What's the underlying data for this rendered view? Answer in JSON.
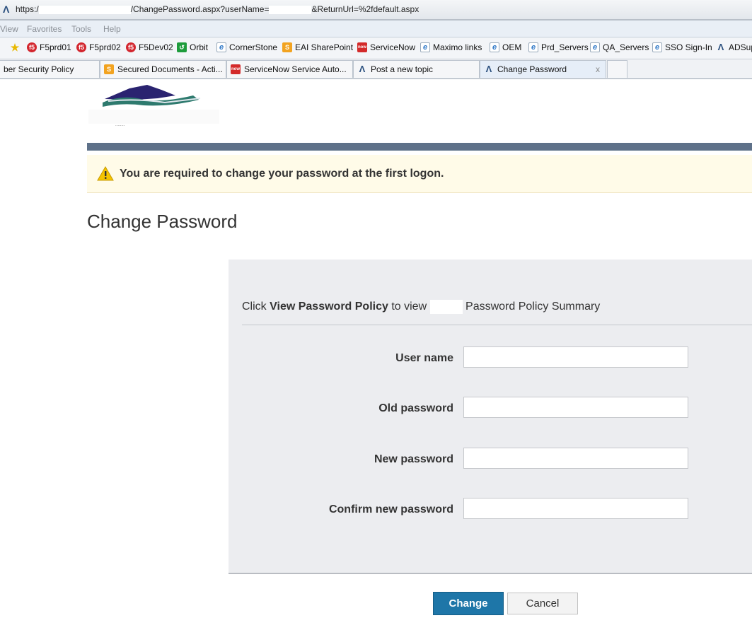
{
  "browser": {
    "address_bar": {
      "prefix": "https:/",
      "path": "/ChangePassword.aspx?userName=",
      "suffix": "&ReturnUrl=%2fdefault.aspx"
    },
    "menu": [
      "View",
      "Favorites",
      "Tools",
      "Help"
    ],
    "favorites": [
      {
        "icon": "f5-icon",
        "label": "F5prd01"
      },
      {
        "icon": "f5-icon",
        "label": "F5prd02"
      },
      {
        "icon": "f5-icon",
        "label": "F5Dev02"
      },
      {
        "icon": "orbit-icon",
        "label": "Orbit"
      },
      {
        "icon": "ie-page-icon",
        "label": "CornerStone"
      },
      {
        "icon": "sharepoint-icon",
        "label": "EAI SharePoint"
      },
      {
        "icon": "servicenow-icon",
        "label": "ServiceNow"
      },
      {
        "icon": "ie-page-icon",
        "label": "Maximo links"
      },
      {
        "icon": "ie-page-icon",
        "label": "OEM"
      },
      {
        "icon": "ie-page-icon",
        "label": "Prd_Servers"
      },
      {
        "icon": "ie-page-icon",
        "label": "QA_Servers"
      },
      {
        "icon": "ie-page-icon",
        "label": "SSO Sign-In"
      },
      {
        "icon": "site-icon",
        "label": "ADSup"
      }
    ],
    "tabs": [
      {
        "label": "ber Security Policy",
        "active": false
      },
      {
        "label": "Secured Documents - Acti...",
        "active": false
      },
      {
        "label": "ServiceNow Service Auto...",
        "active": false
      },
      {
        "label": "Post a new topic",
        "active": false
      },
      {
        "label": "Change Password",
        "active": true
      }
    ],
    "tab_close": "x"
  },
  "page": {
    "warning": "You are required to change your password at the first logon.",
    "title": "Change Password",
    "policy": {
      "pre": "Click ",
      "link": "View Password Policy",
      "mid": " to view ",
      "post": " Password Policy Summary"
    },
    "fields": [
      {
        "label": "User name",
        "value": ""
      },
      {
        "label": "Old password",
        "value": ""
      },
      {
        "label": "New password",
        "value": ""
      },
      {
        "label": "Confirm new password",
        "value": ""
      }
    ],
    "buttons": {
      "change": "Change",
      "cancel": "Cancel"
    }
  },
  "colors": {
    "accent": "#1e76a8",
    "banner": "#5e7189",
    "warning_bg": "#fffbe8",
    "panel_bg": "#ecedf0"
  }
}
